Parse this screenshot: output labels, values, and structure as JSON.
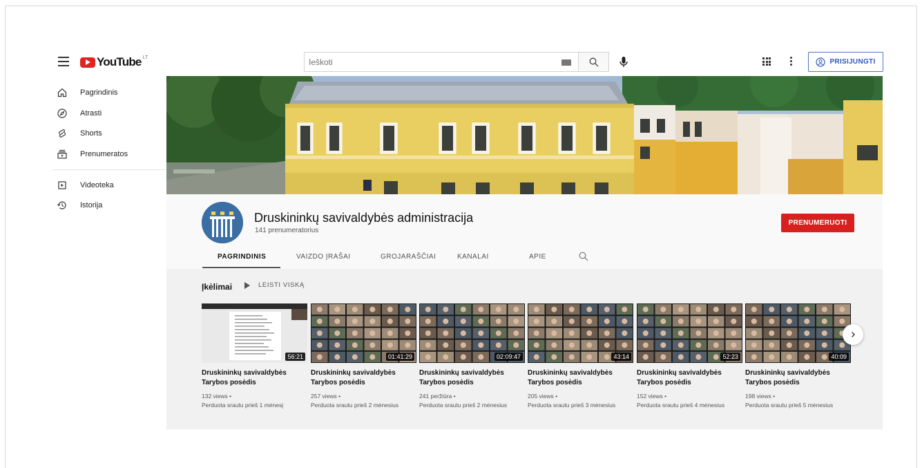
{
  "header": {
    "logo_text": "YouTube",
    "logo_sup": "LT",
    "search_placeholder": "Ieškoti",
    "signin_label": "PRISIJUNGTI"
  },
  "sidebar": {
    "items": [
      {
        "label": "Pagrindinis",
        "icon": "home-icon"
      },
      {
        "label": "Atrasti",
        "icon": "compass-icon"
      },
      {
        "label": "Shorts",
        "icon": "shorts-icon"
      },
      {
        "label": "Prenumeratos",
        "icon": "subscriptions-icon"
      },
      {
        "label": "Videoteka",
        "icon": "library-icon"
      },
      {
        "label": "Istorija",
        "icon": "history-icon"
      }
    ]
  },
  "channel": {
    "name": "Druskininkų savivaldybės administracija",
    "subscribers": "141 prenumeratorius",
    "subscribe_label": "PRENUMERUOTI",
    "tabs": [
      "PAGRINDINIS",
      "VAIZDO ĮRAŠAI",
      "GROJARAŠČIAI",
      "KANALAI",
      "APIE"
    ],
    "active_tab": 0
  },
  "shelf": {
    "title": "Įkėlimai",
    "play_all": "LEISTI VISKĄ"
  },
  "videos": [
    {
      "title": "Druskininkų savivaldybės Tarybos posėdis",
      "views": "132 views •",
      "ago": "Perduota srautu prieš 1 mėnesį",
      "duration": "56:21"
    },
    {
      "title": "Druskininkų savivaldybės Tarybos posėdis",
      "views": "257 views •",
      "ago": "Perduota srautu prieš 2 mėnesius",
      "duration": "01:41:29"
    },
    {
      "title": "Druskininkų savivaldybės Tarybos posėdis",
      "views": "241 peržiūra •",
      "ago": "Perduota srautu prieš 2 mėnesius",
      "duration": "02:09:47"
    },
    {
      "title": "Druskininkų savivaldybės Tarybos posėdis",
      "views": "205 views •",
      "ago": "Perduota srautu prieš 3 mėnesius",
      "duration": "43:14"
    },
    {
      "title": "Druskininkų savivaldybės Tarybos posėdis",
      "views": "152 views •",
      "ago": "Perduota srautu prieš 4 mėnesius",
      "duration": "52:23"
    },
    {
      "title": "Druskininkų savivaldybės Tarybos posėdis",
      "views": "198 views •",
      "ago": "Perduota srautu prieš 5 mėnesius",
      "duration": "40:09"
    }
  ],
  "colors": {
    "brand_red": "#e02424",
    "subscribe_red": "#d8201f",
    "signin_blue": "#2a5bb8",
    "avatar_blue": "#3b6ea3",
    "building_yellow": "#e9cf62"
  }
}
